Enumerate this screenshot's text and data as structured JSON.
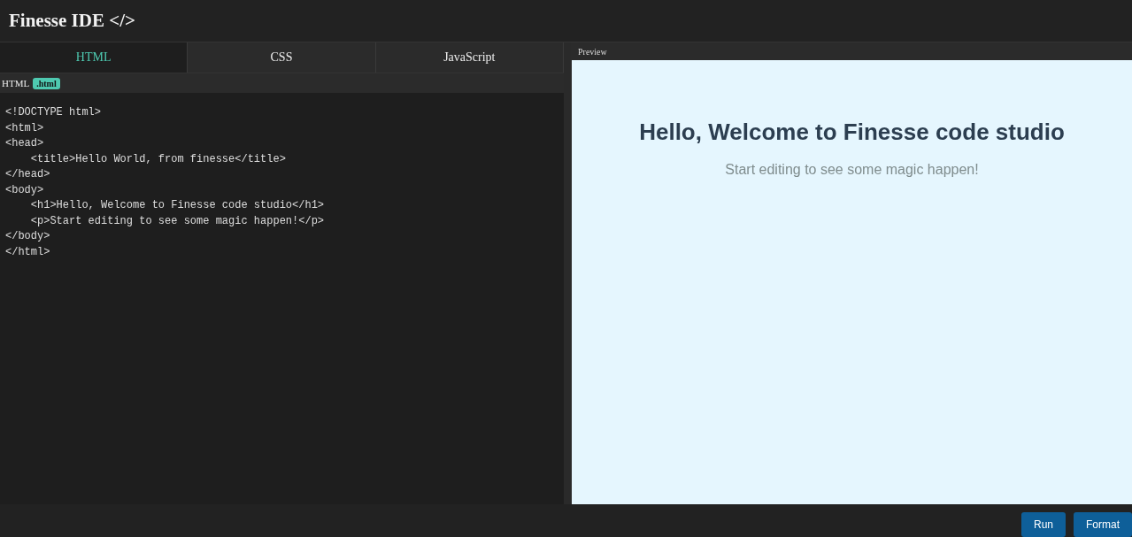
{
  "header": {
    "title": "Finesse IDE </>"
  },
  "tabs": [
    {
      "label": "HTML",
      "selected": true
    },
    {
      "label": "CSS",
      "selected": false
    },
    {
      "label": "JavaScript",
      "selected": false
    }
  ],
  "file_bar": {
    "language": "HTML",
    "badge": ".html"
  },
  "editor": {
    "lines": [
      "<!DOCTYPE html>",
      "<html>",
      "<head>",
      "    <title>Hello World, from finesse</title>",
      "</head>",
      "<body>",
      "    <h1>Hello, Welcome to Finesse code studio</h1>",
      "    <p>Start editing to see some magic happen!</p>",
      "</body>",
      "</html>"
    ]
  },
  "preview": {
    "label": "Preview",
    "heading": "Hello, Welcome to Finesse code studio",
    "paragraph": "Start editing to see some magic happen!"
  },
  "buttons": [
    "Run",
    "Format"
  ]
}
